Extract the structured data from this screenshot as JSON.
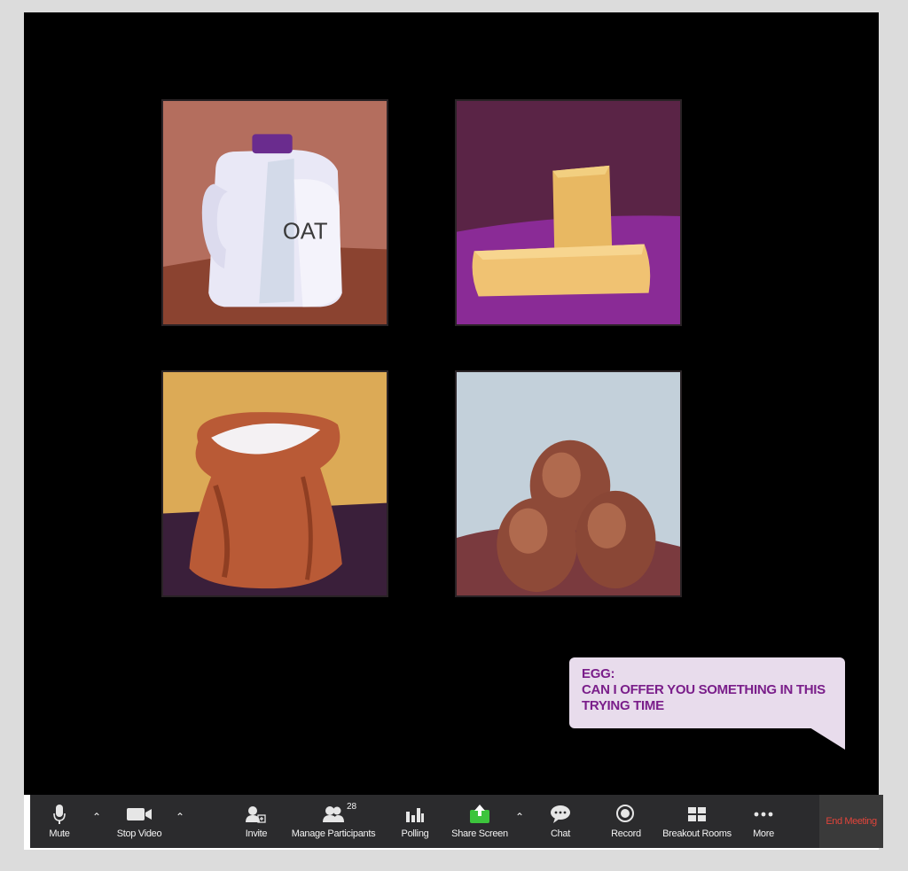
{
  "stage": {
    "tiles": [
      {
        "id": "oat",
        "label": "OAT"
      },
      {
        "id": "butter"
      },
      {
        "id": "flour"
      },
      {
        "id": "eggs"
      }
    ]
  },
  "chat": {
    "speaker": "EGG:",
    "line1": "CAN I OFFER YOU SOMETHING IN THIS",
    "line2": "TRYING TIME"
  },
  "toolbar": {
    "mute": {
      "label": "Mute",
      "icon": "microphone-icon"
    },
    "stop_video": {
      "label": "Stop Video",
      "icon": "video-camera-icon"
    },
    "invite": {
      "label": "Invite",
      "icon": "add-user-icon"
    },
    "participants": {
      "label": "Manage Participants",
      "count": "28",
      "icon": "participants-icon"
    },
    "polling": {
      "label": "Polling",
      "icon": "bar-chart-icon"
    },
    "share_screen": {
      "label": "Share Screen",
      "icon": "share-arrow-icon",
      "color": "#3cc43c"
    },
    "chat": {
      "label": "Chat",
      "icon": "speech-bubble-icon"
    },
    "record": {
      "label": "Record",
      "icon": "record-icon"
    },
    "breakout": {
      "label": "Breakout Rooms",
      "icon": "grid-icon"
    },
    "more": {
      "label": "More",
      "icon": "ellipsis-icon"
    },
    "end_meeting": {
      "label": "End Meeting",
      "color": "#e0443a"
    }
  },
  "colors": {
    "stage_bg": "#000000",
    "toolbar_bg": "#2b2b2d",
    "bubble_bg": "#e8dcec",
    "bubble_text": "#7a1e8a"
  }
}
